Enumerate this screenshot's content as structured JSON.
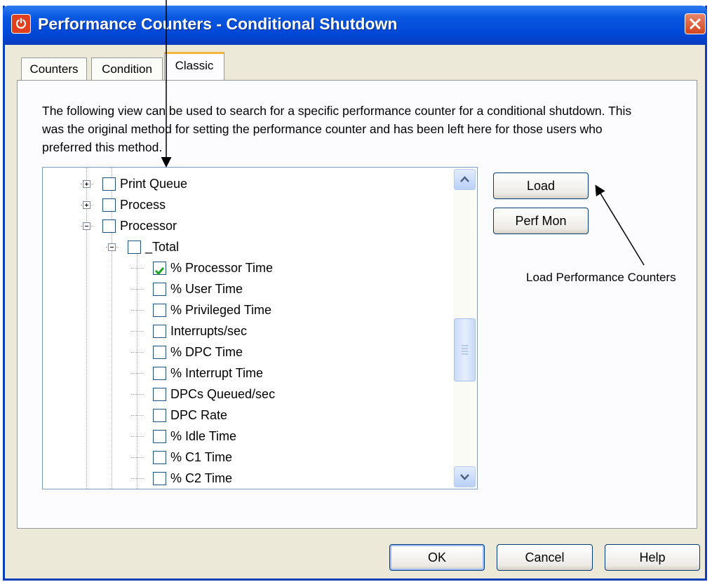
{
  "window": {
    "title": "Performance Counters - Conditional Shutdown",
    "icon": "app-icon",
    "close_icon": "close-icon"
  },
  "tabs": [
    {
      "label": "Counters",
      "active": false
    },
    {
      "label": "Condition",
      "active": false
    },
    {
      "label": "Classic",
      "active": true
    }
  ],
  "classic": {
    "description": "The following view can be used to search for a specific performance counter for a conditional shutdown. This was the original method for setting the performance counter and has been left here for those users who preferred this method.",
    "tree": [
      {
        "label": "Print Queue",
        "expander": "plus",
        "checked": false
      },
      {
        "label": "Process",
        "expander": "plus",
        "checked": false
      },
      {
        "label": "Processor",
        "expander": "minus",
        "checked": false
      },
      {
        "label": "_Total",
        "expander": "minus",
        "checked": false
      },
      {
        "label": "% Processor Time",
        "checked": true
      },
      {
        "label": "% User Time",
        "checked": false
      },
      {
        "label": "% Privileged Time",
        "checked": false
      },
      {
        "label": "Interrupts/sec",
        "checked": false
      },
      {
        "label": "% DPC Time",
        "checked": false
      },
      {
        "label": "% Interrupt Time",
        "checked": false
      },
      {
        "label": "DPCs Queued/sec",
        "checked": false
      },
      {
        "label": "DPC Rate",
        "checked": false
      },
      {
        "label": "% Idle Time",
        "checked": false
      },
      {
        "label": "% C1 Time",
        "checked": false
      },
      {
        "label": "% C2 Time",
        "checked": false
      }
    ],
    "load_label": "Load",
    "perfmon_label": "Perf Mon"
  },
  "footer": {
    "ok_label": "OK",
    "cancel_label": "Cancel",
    "help_label": "Help"
  },
  "annotations": {
    "load_note": "Load Performance Counters"
  },
  "colors": {
    "titlebar": "#0055e5",
    "window_bg": "#ece9d8",
    "check_green": "#21a121"
  }
}
